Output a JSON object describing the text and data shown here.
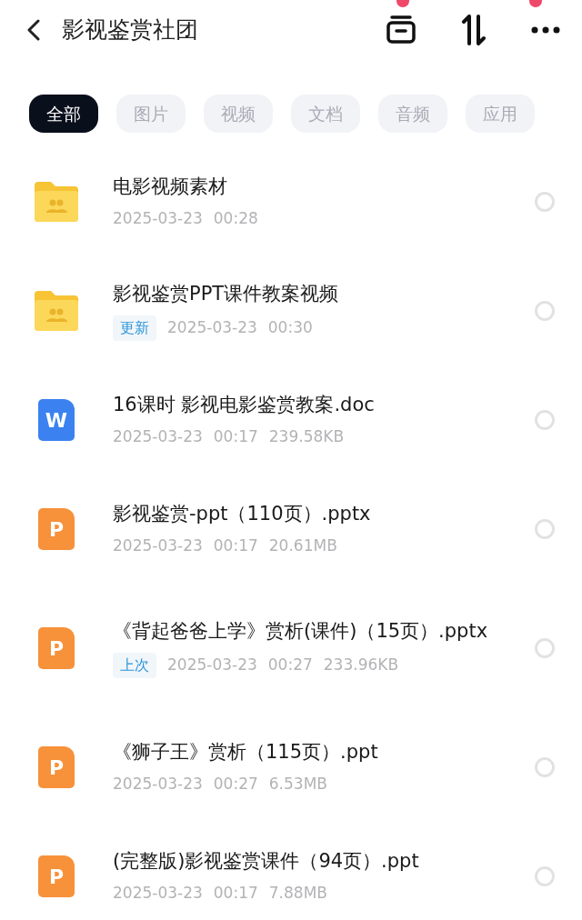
{
  "header": {
    "title": "影视鉴赏社团"
  },
  "tabs": [
    {
      "label": "全部",
      "selected": true
    },
    {
      "label": "图片",
      "selected": false
    },
    {
      "label": "视频",
      "selected": false
    },
    {
      "label": "文档",
      "selected": false
    },
    {
      "label": "音频",
      "selected": false
    },
    {
      "label": "应用",
      "selected": false
    }
  ],
  "files": [
    {
      "kind": "folder",
      "name": "电影视频素材",
      "meta": [
        "2025-03-23",
        "00:28"
      ],
      "selected": false
    },
    {
      "kind": "folder",
      "name": "影视鉴赏PPT课件教案视频",
      "tag": "更新",
      "meta": [
        "2025-03-23",
        "00:30"
      ],
      "selected": false
    },
    {
      "kind": "word",
      "icon_letter": "W",
      "name": "16课时 影视电影鉴赏教案.doc",
      "meta": [
        "2025-03-23",
        "00:17",
        "239.58KB"
      ],
      "selected": false
    },
    {
      "kind": "ppt",
      "icon_letter": "P",
      "name": "影视鉴赏-ppt（110页）.pptx",
      "meta": [
        "2025-03-23",
        "00:17",
        "20.61MB"
      ],
      "selected": false
    },
    {
      "kind": "ppt",
      "icon_letter": "P",
      "name": "《背起爸爸上学》赏析(课件)（15页）.pptx",
      "tag": "上次",
      "meta": [
        "2025-03-23",
        "00:27",
        "233.96KB"
      ],
      "selected": false
    },
    {
      "kind": "ppt",
      "icon_letter": "P",
      "name": "《狮子王》赏析（115页）.ppt",
      "meta": [
        "2025-03-23",
        "00:27",
        "6.53MB"
      ],
      "selected": false
    },
    {
      "kind": "ppt",
      "icon_letter": "P",
      "name": "(完整版)影视鉴赏课件（94页）.ppt",
      "meta": [
        "2025-03-23",
        "00:17",
        "7.88MB"
      ],
      "selected": false
    }
  ]
}
